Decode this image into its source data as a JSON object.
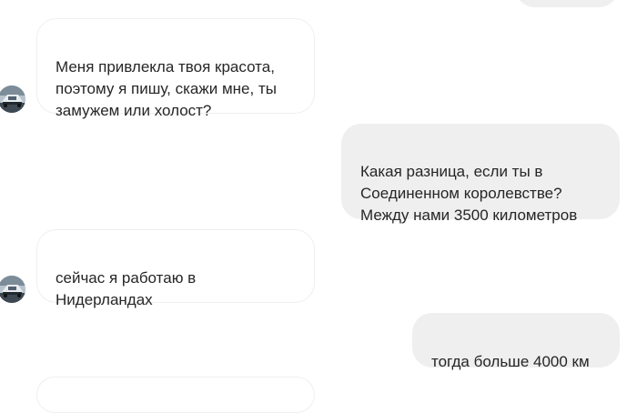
{
  "conversation": {
    "messages": [
      {
        "direction": "incoming",
        "text": "Меня привлекла твоя красота,\nпоэтому я пишу, скажи мне, ты\nзамужем или холост?"
      },
      {
        "direction": "outgoing",
        "text": "Какая разница, если ты в\nСоединенном королевстве?\nМежду нами 3500 километров"
      },
      {
        "direction": "incoming",
        "text": "сейчас я работаю в\nНидерландах"
      },
      {
        "direction": "outgoing",
        "text": "тогда больше 4000 км"
      }
    ]
  }
}
